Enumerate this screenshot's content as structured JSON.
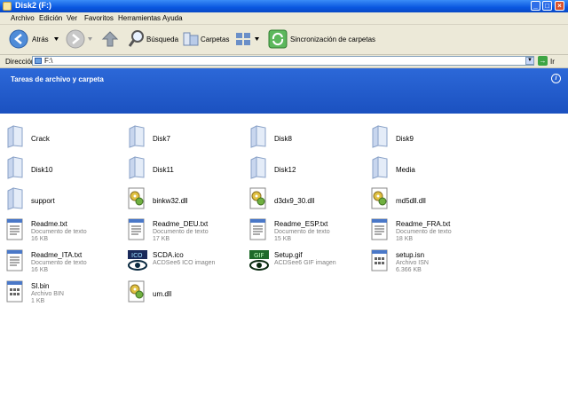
{
  "window": {
    "title": "Disk2 (F:)"
  },
  "menu": [
    "Archivo",
    "Edición",
    "Ver",
    "Favoritos",
    "Herramientas",
    "Ayuda"
  ],
  "toolbar": {
    "back": "Atrás",
    "search": "Búsqueda",
    "folders": "Carpetas",
    "sync": "Sincronización de carpetas"
  },
  "address": {
    "label": "Dirección",
    "value": "F:\\",
    "go": "Ir"
  },
  "taskpane": {
    "title": "Tareas de archivo y carpeta"
  },
  "files": [
    {
      "name": "Crack",
      "kind": "folder"
    },
    {
      "name": "Disk7",
      "kind": "folder"
    },
    {
      "name": "Disk8",
      "kind": "folder"
    },
    {
      "name": "Disk9",
      "kind": "folder"
    },
    {
      "name": "Disk10",
      "kind": "folder"
    },
    {
      "name": "Disk11",
      "kind": "folder"
    },
    {
      "name": "Disk12",
      "kind": "folder"
    },
    {
      "name": "Media",
      "kind": "folder"
    },
    {
      "name": "support",
      "kind": "folder"
    },
    {
      "name": "binkw32.dll",
      "kind": "dll"
    },
    {
      "name": "d3dx9_30.dll",
      "kind": "dll"
    },
    {
      "name": "md5dll.dll",
      "kind": "dll"
    },
    {
      "name": "Readme.txt",
      "kind": "txt",
      "type": "Documento de texto",
      "size": "16 KB"
    },
    {
      "name": "Readme_DEU.txt",
      "kind": "txt",
      "type": "Documento de texto",
      "size": "17 KB"
    },
    {
      "name": "Readme_ESP.txt",
      "kind": "txt",
      "type": "Documento de texto",
      "size": "15 KB"
    },
    {
      "name": "Readme_FRA.txt",
      "kind": "txt",
      "type": "Documento de texto",
      "size": "18 KB"
    },
    {
      "name": "Readme_ITA.txt",
      "kind": "txt",
      "type": "Documento de texto",
      "size": "16 KB"
    },
    {
      "name": "SCDA.ico",
      "kind": "ico",
      "type": "ACDSee6 ICO imagen"
    },
    {
      "name": "Setup.gif",
      "kind": "gif",
      "type": "ACDSee6 GIF imagen"
    },
    {
      "name": "setup.isn",
      "kind": "bin",
      "type": "Archivo ISN",
      "size": "6.366 KB"
    },
    {
      "name": "SI.bin",
      "kind": "bin",
      "type": "Archivo BIN",
      "size": "1 KB"
    },
    {
      "name": "um.dll",
      "kind": "dll"
    }
  ],
  "colors": {
    "titlebar": "#0a57e0",
    "taskpane": "#1b51c0",
    "chrome": "#ece9d8"
  }
}
